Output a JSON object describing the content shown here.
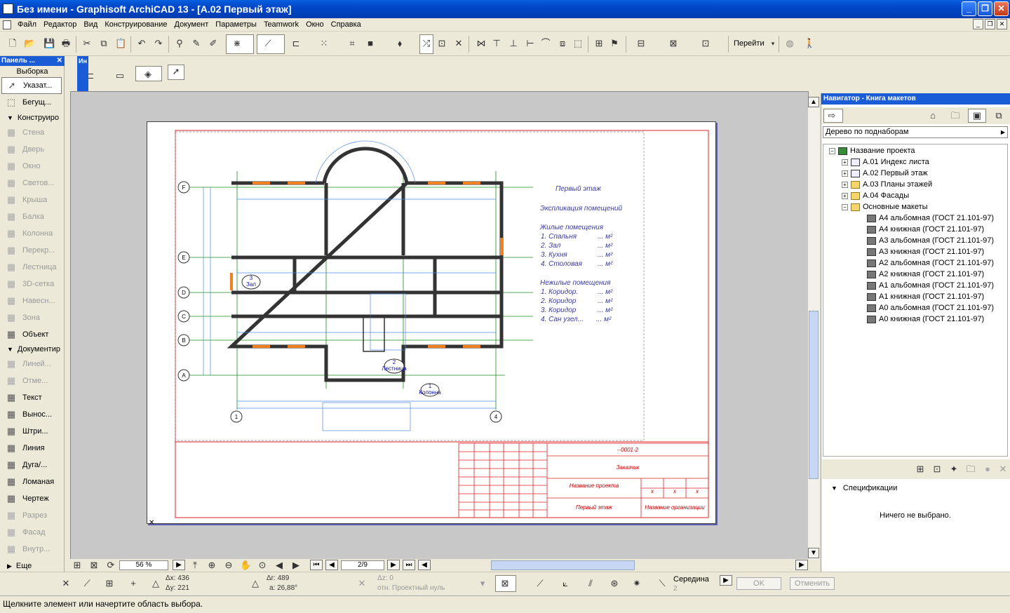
{
  "window": {
    "title": "Без имени - Graphisoft ArchiCAD 13 - [A.02 Первый этаж]"
  },
  "menu": [
    "Файл",
    "Редактор",
    "Вид",
    "Конструирование",
    "Документ",
    "Параметры",
    "Teamwork",
    "Окно",
    "Справка"
  ],
  "toolbar": {
    "goto_label": "Перейти"
  },
  "toolbox": {
    "title": "Панель ...",
    "select_header": "Выборка",
    "select_tools": [
      {
        "label": "Указат...",
        "icon": "arrow-pointer-icon"
      },
      {
        "label": "Бегущ...",
        "icon": "marquee-icon"
      }
    ],
    "design_header": "Конструиро",
    "design_tools": [
      {
        "label": "Стена",
        "icon": "wall-icon"
      },
      {
        "label": "Дверь",
        "icon": "door-icon"
      },
      {
        "label": "Окно",
        "icon": "window-icon"
      },
      {
        "label": "Светов...",
        "icon": "skylight-icon"
      },
      {
        "label": "Крыша",
        "icon": "roof-icon"
      },
      {
        "label": "Балка",
        "icon": "beam-icon"
      },
      {
        "label": "Колонна",
        "icon": "column-icon"
      },
      {
        "label": "Перекр...",
        "icon": "slab-icon"
      },
      {
        "label": "Лестница",
        "icon": "stair-icon"
      },
      {
        "label": "3D-сетка",
        "icon": "mesh-icon"
      },
      {
        "label": "Навесн...",
        "icon": "curtain-wall-icon"
      },
      {
        "label": "Зона",
        "icon": "zone-icon"
      },
      {
        "label": "Объект",
        "icon": "object-icon"
      }
    ],
    "doc_header": "Документир",
    "doc_tools": [
      {
        "label": "Линей...",
        "icon": "dimension-icon"
      },
      {
        "label": "Отме...",
        "icon": "level-icon"
      },
      {
        "label": "Текст",
        "icon": "text-icon"
      },
      {
        "label": "Вынос...",
        "icon": "label-icon"
      },
      {
        "label": "Штри...",
        "icon": "fill-icon"
      },
      {
        "label": "Линия",
        "icon": "line-icon"
      },
      {
        "label": "Дуга/...",
        "icon": "arc-icon"
      },
      {
        "label": "Ломаная",
        "icon": "polyline-icon"
      },
      {
        "label": "Чертеж",
        "icon": "drawing-icon"
      },
      {
        "label": "Разрез",
        "icon": "section-icon"
      },
      {
        "label": "Фасад",
        "icon": "elevation-icon"
      },
      {
        "label": "Внутр...",
        "icon": "interior-icon"
      }
    ],
    "more_header": "Еще"
  },
  "infobox": {
    "side_label": "Ин"
  },
  "drawing": {
    "grid_rows": [
      "F",
      "E",
      "D",
      "C",
      "B",
      "A"
    ],
    "grid_cols": [
      "1",
      "4"
    ],
    "rooms": [
      {
        "num": "3",
        "name": "Зал"
      },
      {
        "num": "2",
        "name": "Лестница"
      },
      {
        "num": "1",
        "name": "Колонна"
      }
    ],
    "legend_title": "Первый этаж",
    "legend_subtitle": "Экспликация помещений",
    "living_header": "Жилые помещения",
    "living": [
      "1. Спальня",
      "2. Зал",
      "3. Кухня",
      "4. Столовая"
    ],
    "nonliving_header": "Нежилые помещения",
    "nonliving": [
      "1. Коридор.",
      "2. Коридор",
      "3. Коридор",
      "4. Сан узел..."
    ],
    "area_unit": "... м²",
    "stamp": {
      "code": "--0001-2",
      "client": "Заказчик",
      "project": "Название проекта",
      "x": "x",
      "sheet": "Первый этаж",
      "org": "Название организации"
    }
  },
  "navigator": {
    "title": "Навигатор - Книга макетов",
    "dropdown": "Дерево по поднаборам",
    "root": "Название проекта",
    "items": [
      {
        "label": "A.01  Индекс листа",
        "icon": "layout-icon"
      },
      {
        "label": "A.02 Первый этаж",
        "icon": "layout-icon"
      },
      {
        "label": "A.03 Планы этажей",
        "icon": "folder-icon"
      },
      {
        "label": "A.04 Фасады",
        "icon": "folder-icon"
      },
      {
        "label": "Основные макеты",
        "icon": "folder-icon"
      }
    ],
    "masters": [
      "A4 альбомная (ГОСТ 21.101-97)",
      "A4 книжная (ГОСТ 21.101-97)",
      "A3 альбомная (ГОСТ 21.101-97)",
      "A3 книжная (ГОСТ 21.101-97)",
      "A2 альбомная (ГОСТ 21.101-97)",
      "A2 книжная (ГОСТ 21.101-97)",
      "A1 альбомная (ГОСТ 21.101-97)",
      "A1 книжная (ГОСТ 21.101-97)",
      "A0 альбомная (ГОСТ 21.101-97)",
      "A0 книжная (ГОСТ 21.101-97)"
    ],
    "spec_header": "Спецификации",
    "spec_empty": "Ничего не выбрано."
  },
  "zoom": {
    "value": "56 %",
    "page": "2/9"
  },
  "coords": {
    "dx": "Δx: 436",
    "dy": "Δy: 221",
    "dr": "Δr: 489",
    "a": "a: 26,88°",
    "dz": "Δz: 0",
    "ref": "отн. Проектный нуль",
    "mid": "Середина",
    "mid_n": "2"
  },
  "buttons": {
    "ok": "OK",
    "cancel": "Отменить"
  },
  "status": "Щелкните элемент или начертите область выбора."
}
